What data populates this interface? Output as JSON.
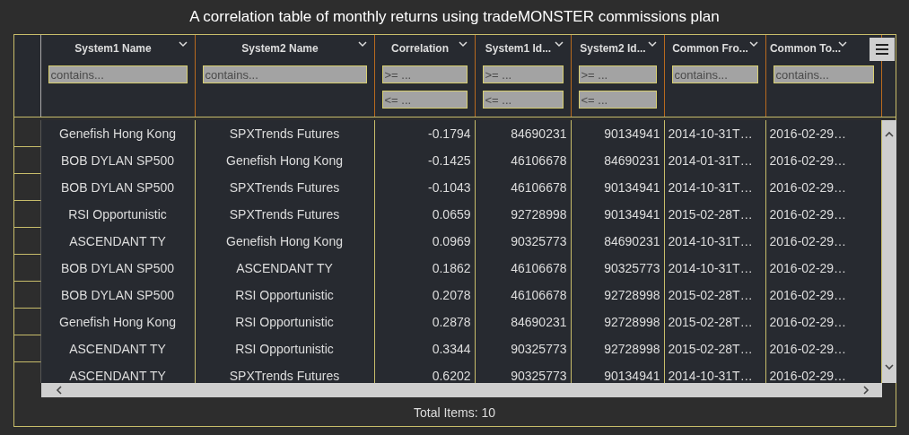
{
  "title": "A correlation table of monthly returns using tradeMONSTER commissions plan",
  "columns": [
    {
      "title": "System1 Name",
      "kind": "text",
      "filters": [
        {
          "placeholder": "contains..."
        }
      ]
    },
    {
      "title": "System2 Name",
      "kind": "text",
      "filters": [
        {
          "placeholder": "contains..."
        }
      ]
    },
    {
      "title": "Correlation",
      "kind": "number",
      "filters": [
        {
          "placeholder": ">= ..."
        },
        {
          "placeholder": "<= ..."
        }
      ]
    },
    {
      "title": "System1 Id...",
      "kind": "number",
      "filters": [
        {
          "placeholder": ">= ..."
        },
        {
          "placeholder": "<= ..."
        }
      ]
    },
    {
      "title": "System2 Id...",
      "kind": "number",
      "filters": [
        {
          "placeholder": ">= ..."
        },
        {
          "placeholder": "<= ..."
        }
      ]
    },
    {
      "title": "Common Fro...",
      "kind": "date",
      "filters": [
        {
          "placeholder": "contains..."
        }
      ]
    },
    {
      "title": "Common To...",
      "kind": "date",
      "filters": [
        {
          "placeholder": "contains..."
        }
      ]
    }
  ],
  "rows": [
    [
      "Genefish Hong Kong",
      "SPXTrends Futures",
      "-0.1794",
      "84690231",
      "90134941",
      "2014-10-31T…",
      "2016-02-29…"
    ],
    [
      "BOB DYLAN SP500",
      "Genefish Hong Kong",
      "-0.1425",
      "46106678",
      "84690231",
      "2014-01-31T…",
      "2016-02-29…"
    ],
    [
      "BOB DYLAN SP500",
      "SPXTrends Futures",
      "-0.1043",
      "46106678",
      "90134941",
      "2014-10-31T…",
      "2016-02-29…"
    ],
    [
      "RSI Opportunistic",
      "SPXTrends Futures",
      "0.0659",
      "92728998",
      "90134941",
      "2015-02-28T…",
      "2016-02-29…"
    ],
    [
      "ASCENDANT TY",
      "Genefish Hong Kong",
      "0.0969",
      "90325773",
      "84690231",
      "2014-10-31T…",
      "2016-02-29…"
    ],
    [
      "BOB DYLAN SP500",
      "ASCENDANT TY",
      "0.1862",
      "46106678",
      "90325773",
      "2014-10-31T…",
      "2016-02-29…"
    ],
    [
      "BOB DYLAN SP500",
      "RSI Opportunistic",
      "0.2078",
      "46106678",
      "92728998",
      "2015-02-28T…",
      "2016-02-29…"
    ],
    [
      "Genefish Hong Kong",
      "RSI Opportunistic",
      "0.2878",
      "84690231",
      "92728998",
      "2015-02-28T…",
      "2016-02-29…"
    ],
    [
      "ASCENDANT TY",
      "RSI Opportunistic",
      "0.3344",
      "90325773",
      "92728998",
      "2015-02-28T…",
      "2016-02-29…"
    ],
    [
      "ASCENDANT TY",
      "SPXTrends Futures",
      "0.6202",
      "90325773",
      "90134941",
      "2014-10-31T…",
      "2016-02-29…"
    ]
  ],
  "footer": "Total Items: 10"
}
